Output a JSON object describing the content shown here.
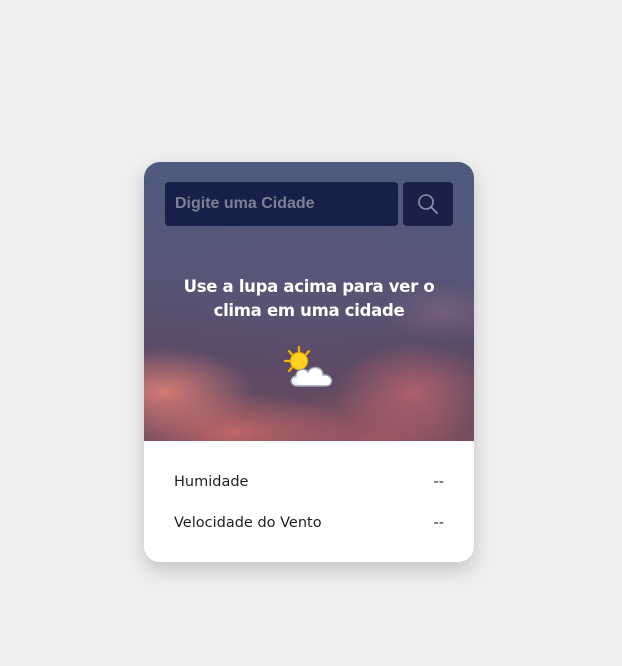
{
  "search": {
    "placeholder": "Digite uma Cidade",
    "value": ""
  },
  "hero": {
    "message": "Use a lupa acima para ver o clima em uma cidade",
    "weather_icon": "partly-cloudy-icon"
  },
  "icons": {
    "search_button": "magnifier-icon"
  },
  "details": {
    "humidity_label": "Humidade",
    "humidity_value": "--",
    "wind_label": "Velocidade do Vento",
    "wind_value": "--"
  },
  "colors": {
    "page_background": "#efefef",
    "input_background": "#162049",
    "button_background": "#1a2148",
    "card_bottom": "#ffffff"
  }
}
